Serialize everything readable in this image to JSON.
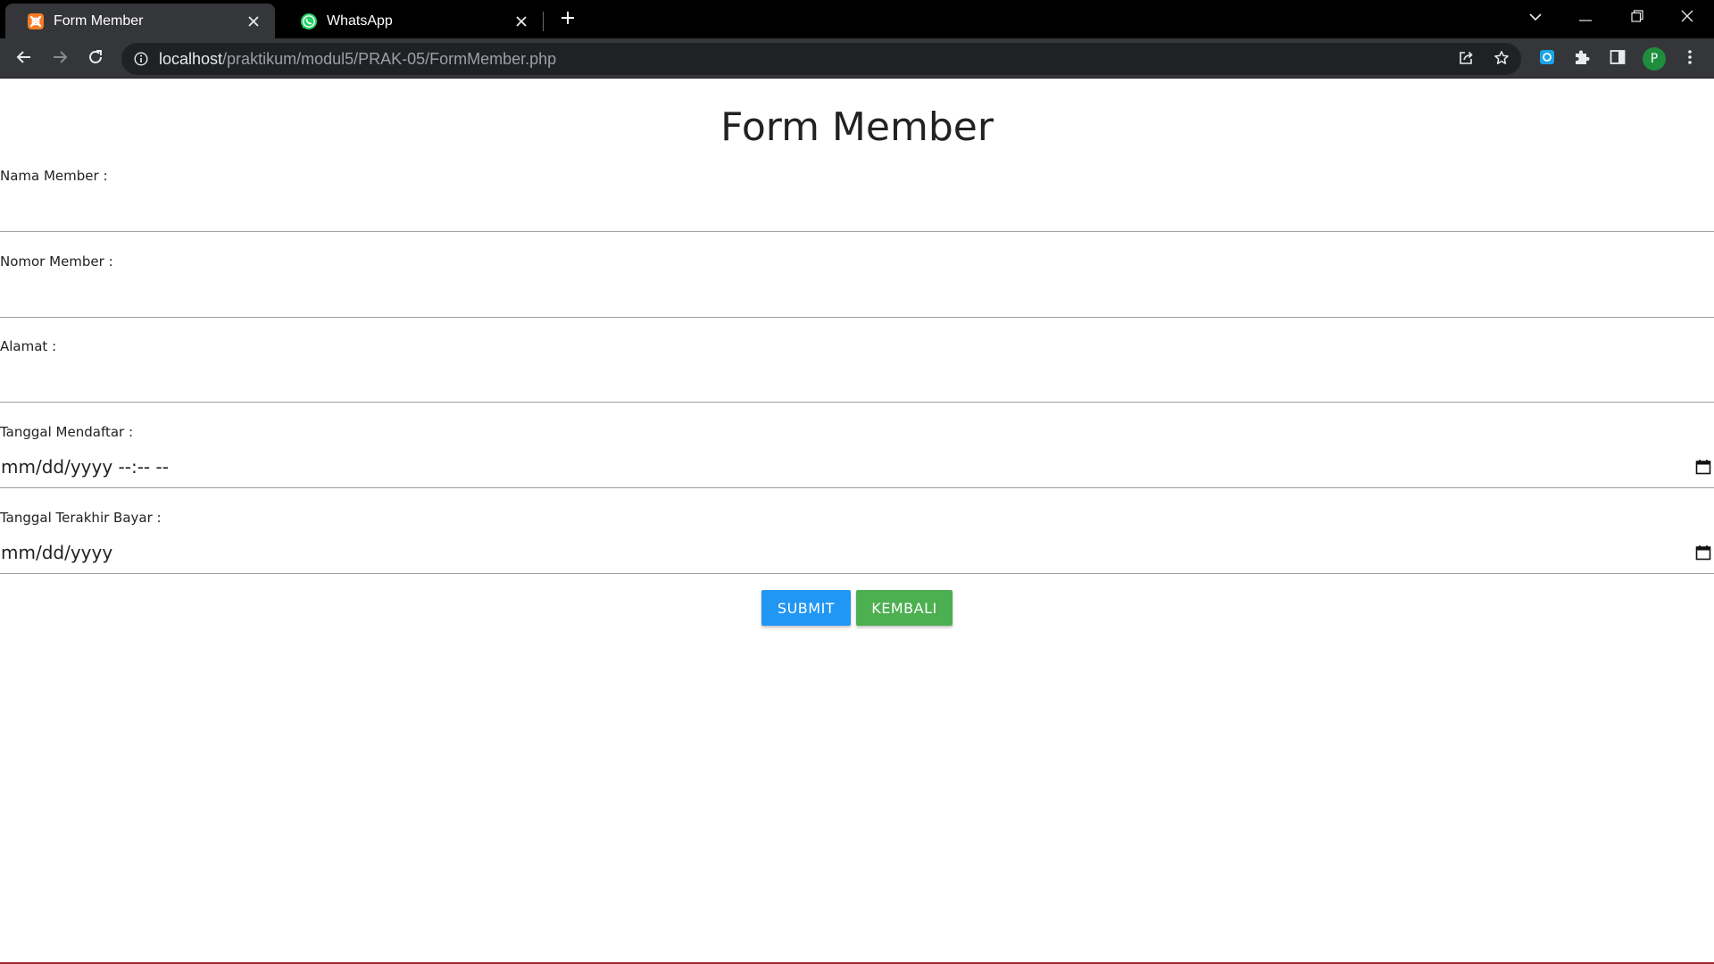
{
  "browser": {
    "tabs": [
      {
        "title": "Form Member",
        "active": true,
        "icon": "xampp-icon"
      },
      {
        "title": "WhatsApp",
        "active": false,
        "icon": "whatsapp-icon"
      }
    ],
    "url": {
      "host": "localhost",
      "path": "/praktikum/modul5/PRAK-05/FormMember.php"
    },
    "profile_initial": "P",
    "colors": {
      "tabstrip": "#000000",
      "toolbar": "#35363a",
      "omnibox": "#202124"
    }
  },
  "form": {
    "title": "Form Member",
    "fields": [
      {
        "label": "Nama Member :",
        "value": ""
      },
      {
        "label": "Nomor Member :",
        "value": ""
      },
      {
        "label": "Alamat :",
        "value": ""
      },
      {
        "label": "Tanggal Mendaftar :",
        "value": "mm/dd/yyyy --:-- --"
      },
      {
        "label": "Tanggal Terakhir Bayar :",
        "value": "mm/dd/yyyy"
      }
    ],
    "buttons": {
      "submit": "SUBMIT",
      "back": "KEMBALI"
    },
    "colors": {
      "submit": "#2196f3",
      "back": "#4caf50"
    }
  }
}
